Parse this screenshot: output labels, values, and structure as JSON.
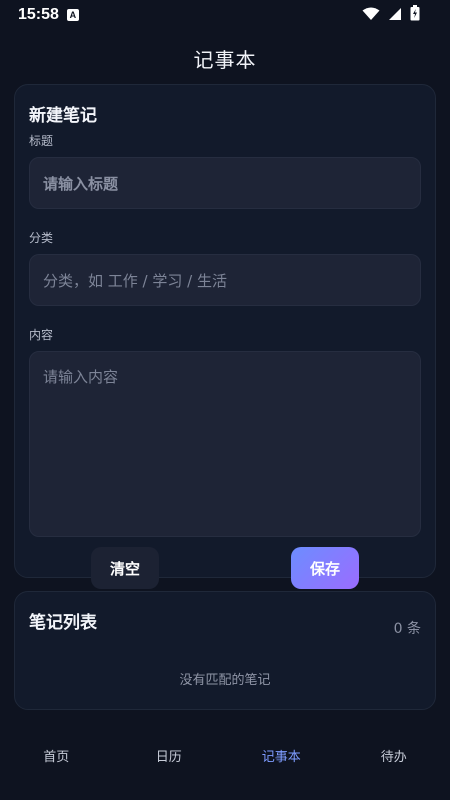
{
  "status_bar": {
    "time": "15:58",
    "notif_letter": "A"
  },
  "header": {
    "title": "记事本"
  },
  "new_note": {
    "title": "新建笔记",
    "title_label": "标题",
    "title_placeholder": "请输入标题",
    "category_label": "分类",
    "category_placeholder": "分类，如 工作 / 学习 / 生活",
    "content_label": "内容",
    "content_placeholder": "请输入内容",
    "clear_label": "清空",
    "save_label": "保存"
  },
  "note_list": {
    "title": "笔记列表",
    "count": "0 条",
    "empty_text": "没有匹配的笔记"
  },
  "bottom_nav": {
    "items": [
      {
        "label": "首页",
        "active": false
      },
      {
        "label": "日历",
        "active": false
      },
      {
        "label": "记事本",
        "active": true
      },
      {
        "label": "待办",
        "active": false
      }
    ]
  },
  "colors": {
    "accent": "#7e9cff",
    "save_gradient_start": "#6c8dff",
    "save_gradient_end": "#9b6cff",
    "background": "#0e1320"
  }
}
